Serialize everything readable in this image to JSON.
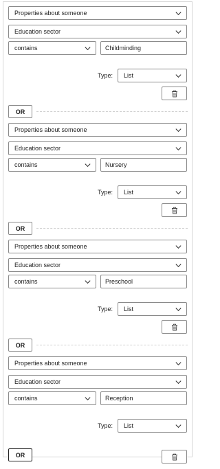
{
  "criteria": [
    {
      "property": "Properties about someone",
      "field": "Education sector",
      "operator": "contains",
      "value": "Childminding",
      "type_label": "Type:",
      "type_value": "List"
    },
    {
      "property": "Properties about someone",
      "field": "Education sector",
      "operator": "contains",
      "value": "Nursery",
      "type_label": "Type:",
      "type_value": "List"
    },
    {
      "property": "Properties about someone",
      "field": "Education sector",
      "operator": "contains",
      "value": "Preschool",
      "type_label": "Type:",
      "type_value": "List"
    },
    {
      "property": "Properties about someone",
      "field": "Education sector",
      "operator": "contains",
      "value": "Reception",
      "type_label": "Type:",
      "type_value": "List"
    }
  ],
  "or_label": "OR",
  "icons": {
    "dropdown": "chevron-down-icon",
    "delete": "trash-icon"
  },
  "colors": {
    "border": "#8a8a8a",
    "divider": "#cfcfcf"
  }
}
